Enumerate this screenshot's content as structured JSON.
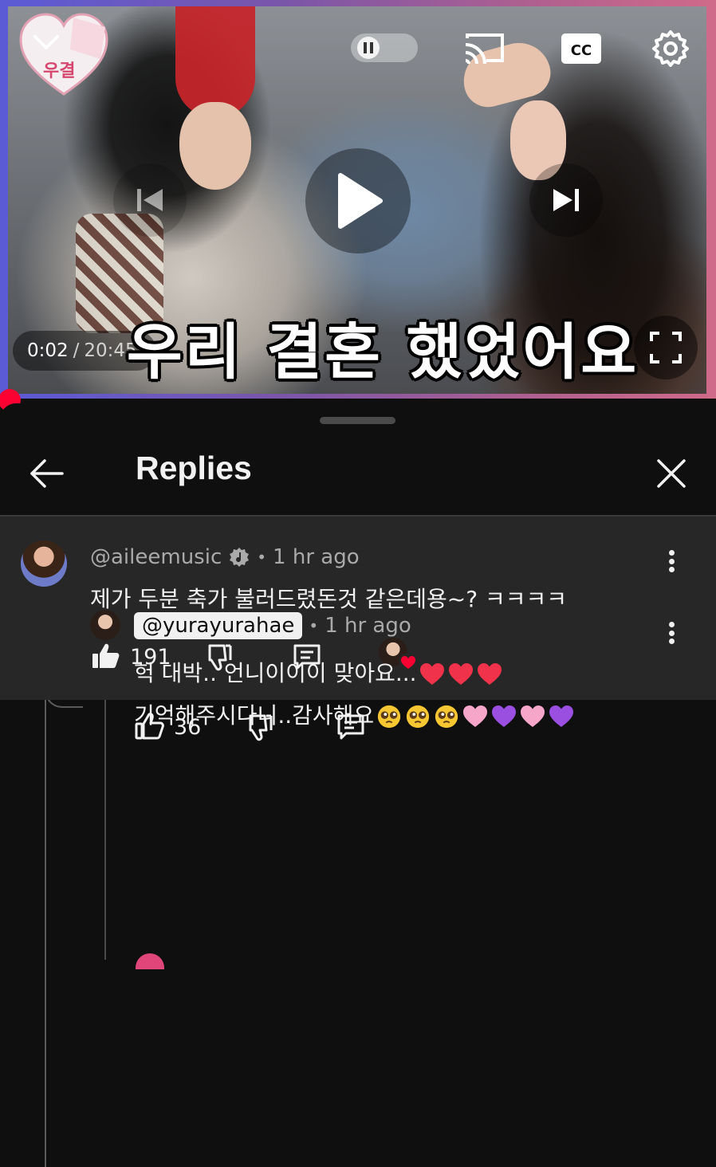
{
  "player": {
    "current_time": "0:02",
    "separator": "/",
    "duration": "20:45",
    "caption": "우리 결혼 했었어요",
    "progress_fraction": 0.001,
    "logo_text": "우결"
  },
  "replies_panel": {
    "title": "Replies"
  },
  "parent_comment": {
    "handle": "@aileemusic",
    "time": "1 hr ago",
    "text": "제가 두분 축가 불러드렸돈것 같은데용~?  ㅋㅋㅋㅋ",
    "likes": "191"
  },
  "reply": {
    "handle": "@yurayurahae",
    "time": "1 hr ago",
    "line1_text": "헉 대박.. 언니이이이 맞아요...",
    "line2_text": "기억해주시다니..감사해요",
    "likes": "36"
  },
  "colors": {
    "accent_red": "#ff0033",
    "background": "#0f0f0f",
    "highlight_row": "#272727",
    "meta_text": "#aaaaaa"
  },
  "icons": [
    "chevron-down-icon",
    "pause-icon",
    "cast-icon",
    "closed-captions-icon",
    "settings-gear-icon",
    "previous-icon",
    "play-icon",
    "next-icon",
    "fullscreen-icon",
    "back-arrow-icon",
    "close-icon",
    "verified-music-icon",
    "more-vert-icon",
    "like-icon",
    "dislike-icon",
    "reply-icon",
    "creator-heart-icon"
  ]
}
